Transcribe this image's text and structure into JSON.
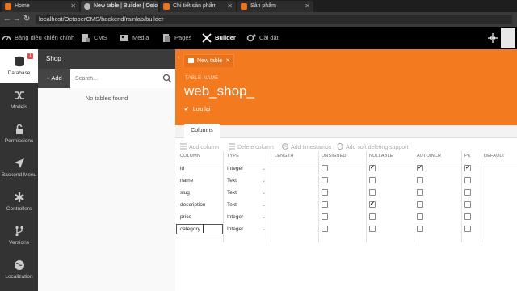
{
  "browser": {
    "tabs": [
      {
        "title": "Home",
        "color": "#e8741e"
      },
      {
        "title": "New table | Builder | Octo",
        "color": "#cccccc"
      },
      {
        "title": "Chi tiết sản phẩm",
        "color": "#e8741e"
      },
      {
        "title": "Sản phẩm",
        "color": "#e8741e"
      }
    ],
    "url": "localhost/OctoberCMS/backend/rainlab/builder"
  },
  "topnav": {
    "items": [
      {
        "label": "Bảng điều khiển chính",
        "icon": "dashboard-icon"
      },
      {
        "label": "CMS",
        "icon": "cms-icon"
      },
      {
        "label": "Media",
        "icon": "media-icon"
      },
      {
        "label": "Pages",
        "icon": "pages-icon"
      },
      {
        "label": "Builder",
        "icon": "builder-icon"
      },
      {
        "label": "Cài đặt",
        "icon": "settings-icon"
      }
    ]
  },
  "sidebar": {
    "items": [
      {
        "label": "Database",
        "badge": "1"
      },
      {
        "label": "Models"
      },
      {
        "label": "Permissions"
      },
      {
        "label": "Backend Menu"
      },
      {
        "label": "Controllers"
      },
      {
        "label": "Versions"
      },
      {
        "label": "Localization"
      }
    ]
  },
  "shop": {
    "title": "Shop",
    "add_label": "+ Add",
    "search_placeholder": "Search...",
    "empty_text": "No tables found"
  },
  "editor": {
    "tab_label": "New table",
    "table_name_label": "TABLE NAME",
    "table_name": "web_shop_",
    "save_label": "Lưu lại",
    "columns_tab": "Columns",
    "toolbar": {
      "add_column": "Add column",
      "delete_column": "Delete column",
      "add_timestamps": "Add timestamps",
      "add_soft_delete": "Add soft deleting support"
    },
    "headers": [
      "COLUMN",
      "TYPE",
      "LENGTH",
      "UNSIGNED",
      "NULLABLE",
      "AUTOINCR",
      "PK",
      "DEFAULT"
    ],
    "rows": [
      {
        "column": "id",
        "type": "Integer",
        "unsigned": false,
        "nullable": true,
        "autoincr": true,
        "pk": true
      },
      {
        "column": "name",
        "type": "Text",
        "unsigned": false,
        "nullable": false,
        "autoincr": false,
        "pk": false
      },
      {
        "column": "slug",
        "type": "Text",
        "unsigned": false,
        "nullable": false,
        "autoincr": false,
        "pk": false
      },
      {
        "column": "description",
        "type": "Text",
        "unsigned": false,
        "nullable": true,
        "autoincr": false,
        "pk": false
      },
      {
        "column": "price",
        "type": "Integer",
        "unsigned": false,
        "nullable": false,
        "autoincr": false,
        "pk": false
      },
      {
        "column": "category",
        "type": "Integer",
        "unsigned": false,
        "nullable": false,
        "autoincr": false,
        "pk": false
      }
    ]
  },
  "colors": {
    "accent": "#f47a20",
    "topnav": "#000000",
    "sidebar": "#333333"
  }
}
